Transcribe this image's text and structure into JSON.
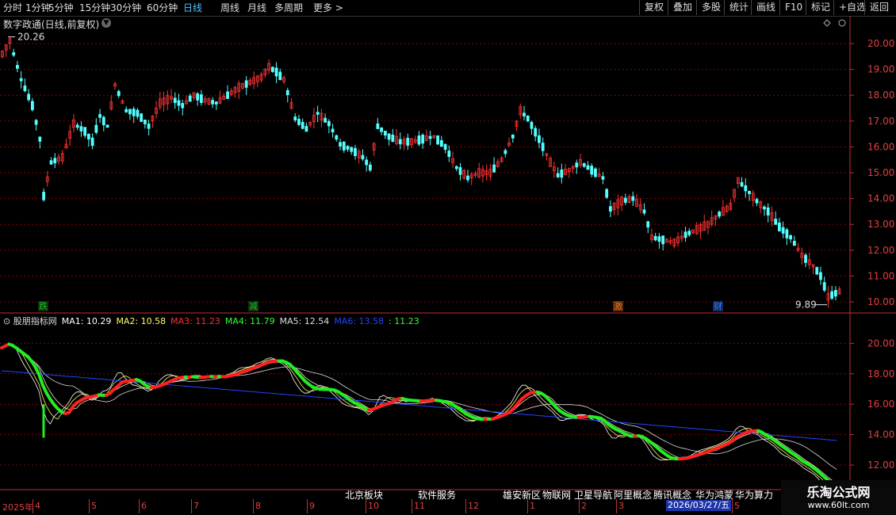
{
  "toolbar": {
    "periods": [
      "分时",
      "1分钟",
      "5分钟",
      "15分钟",
      "30分钟",
      "60分钟",
      "日线",
      "周线",
      "月线",
      "多周期",
      "更多 >"
    ],
    "active": "日线",
    "right_buttons": [
      "复权",
      "叠加",
      "多股",
      "统计",
      "画线",
      "F10",
      "标记",
      "+自选",
      "返回"
    ]
  },
  "main_chart": {
    "title": "数字政通(日线,前复权)",
    "high_label": "20.26",
    "low_label": "9.89",
    "price_ticks": [
      "20.00",
      "19.00",
      "18.00",
      "17.00",
      "16.00",
      "15.00",
      "14.00",
      "13.00",
      "12.00",
      "11.00",
      "10.00"
    ],
    "events": [
      {
        "text": "跌",
        "color": "#20c020"
      },
      {
        "text": "减",
        "color": "#20c020"
      },
      {
        "text": "激",
        "color": "#e07020"
      },
      {
        "text": "财",
        "color": "#3a7aff"
      }
    ]
  },
  "indicator": {
    "name": "股朋指标网",
    "items": [
      {
        "label": "MA1: 10.29",
        "color": "#ffffff"
      },
      {
        "label": "MA2: 10.58",
        "color": "#ffff66"
      },
      {
        "label": "MA3: 11.23",
        "color": "#ff3030"
      },
      {
        "label": "MA4: 11.79",
        "color": "#33ff33"
      },
      {
        "label": "MA5: 12.54",
        "color": "#dddddd"
      },
      {
        "label": "MA6: 13.58",
        "color": "#2244ff"
      },
      {
        "label": ": 11.23",
        "color": "#33ff33"
      }
    ],
    "ticks": [
      "20.00",
      "18.00",
      "16.00",
      "14.00",
      "12.00"
    ]
  },
  "sectors": [
    "北京板块",
    "软件服务",
    "雄安新区",
    "物联网",
    "卫星导航",
    "阿里概念",
    "腾讯概念",
    "华为鸿蒙",
    "华为算力"
  ],
  "timeline": {
    "start": "2025年",
    "months": [
      "4",
      "5",
      "6",
      "7",
      "8",
      "9",
      "10",
      "11",
      "12",
      "1",
      "2",
      "3",
      "5"
    ],
    "current_date": "2026/03/27/五"
  },
  "colors": {
    "up": "#ff3333",
    "down": "#54ffff",
    "grid": "#8b0000",
    "axis": "#c03030"
  },
  "watermark": {
    "name": "乐淘公式网",
    "url": "www.60lt.com"
  }
}
